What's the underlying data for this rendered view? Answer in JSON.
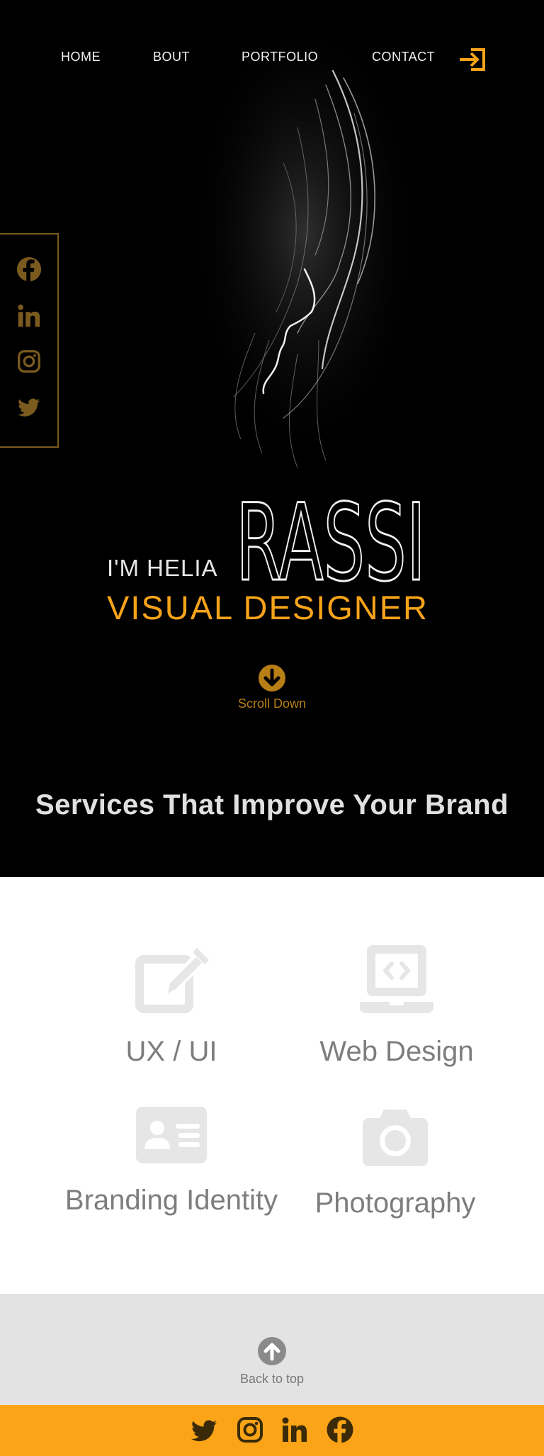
{
  "nav": {
    "home": "HOME",
    "bout": "BOUT",
    "portfolio": "PORTFOLIO",
    "contact": "CONTACT",
    "login_icon": "sign-in-icon"
  },
  "social_sidebar": {
    "icons": [
      "facebook-icon",
      "linkedin-icon",
      "instagram-icon",
      "twitter-icon"
    ],
    "color": "#7a5a1e"
  },
  "hero": {
    "intro": "I'M HELIA",
    "surname": "RASSI",
    "role": "VISUAL DESIGNER",
    "scroll_label": "Scroll Down",
    "scroll_icon": "arrow-circle-down-icon",
    "accent_color": "#f7a319"
  },
  "services": {
    "title": "Services That Improve Your Brand",
    "items": [
      {
        "label": "UX / UI",
        "icon": "edit-icon"
      },
      {
        "label": "Web Design",
        "icon": "laptop-code-icon"
      },
      {
        "label": "Branding Identity",
        "icon": "id-card-icon"
      },
      {
        "label": "Photography",
        "icon": "camera-icon"
      }
    ],
    "icon_color": "#e6e6e6",
    "label_color": "#7d7d7d"
  },
  "back_to_top": {
    "label": "Back to top",
    "icon": "arrow-circle-up-icon"
  },
  "footer": {
    "background": "#fba418",
    "icons": [
      "twitter-icon",
      "instagram-icon",
      "linkedin-icon",
      "facebook-icon"
    ]
  }
}
